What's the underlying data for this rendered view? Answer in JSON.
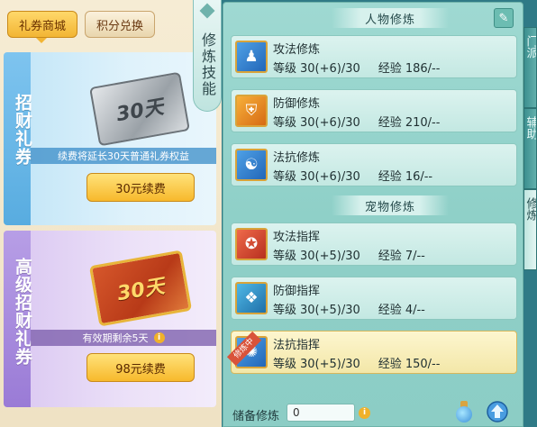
{
  "shop": {
    "tabs": [
      {
        "label": "礼券商城",
        "active": true
      },
      {
        "label": "积分兑换",
        "active": false
      }
    ],
    "cards": [
      {
        "title": "招财礼券",
        "ticket_text": "30天",
        "description": "续费将延长30天普通礼券权益",
        "button": "30元续费"
      },
      {
        "title": "高级招财礼券",
        "ticket_text": "30天",
        "description": "有效期剩余5天",
        "button": "98元续费"
      }
    ]
  },
  "skill_tab": {
    "label": "修炼技能"
  },
  "cultivation": {
    "character_section": "人物修炼",
    "pet_section": "宠物修炼",
    "level_label": "等级",
    "exp_label": "经验",
    "character_skills": [
      {
        "name": "攻法修炼",
        "icon": "attack-magic-icon",
        "level": "30(+6)/30",
        "exp": "186/--"
      },
      {
        "name": "防御修炼",
        "icon": "defense-icon",
        "level": "30(+6)/30",
        "exp": "210/--"
      },
      {
        "name": "法抗修炼",
        "icon": "magic-resist-icon",
        "level": "30(+6)/30",
        "exp": "16/--"
      }
    ],
    "pet_skills": [
      {
        "name": "攻法指挥",
        "icon": "pet-attack-icon",
        "level": "30(+5)/30",
        "exp": "7/--"
      },
      {
        "name": "防御指挥",
        "icon": "pet-defense-icon",
        "level": "30(+5)/30",
        "exp": "4/--"
      },
      {
        "name": "法抗指挥",
        "icon": "pet-resist-icon",
        "level": "30(+5)/30",
        "exp": "150/--",
        "ribbon": "修炼中",
        "selected": true
      }
    ],
    "reserve_label": "储备修炼",
    "reserve_value": "0"
  },
  "side_tabs": [
    "门派",
    "辅助",
    "修炼"
  ],
  "colors": {
    "gold_button": "#f7b92c",
    "panel_teal": "#8fd0c8",
    "selected_row": "#fdf6cf"
  }
}
